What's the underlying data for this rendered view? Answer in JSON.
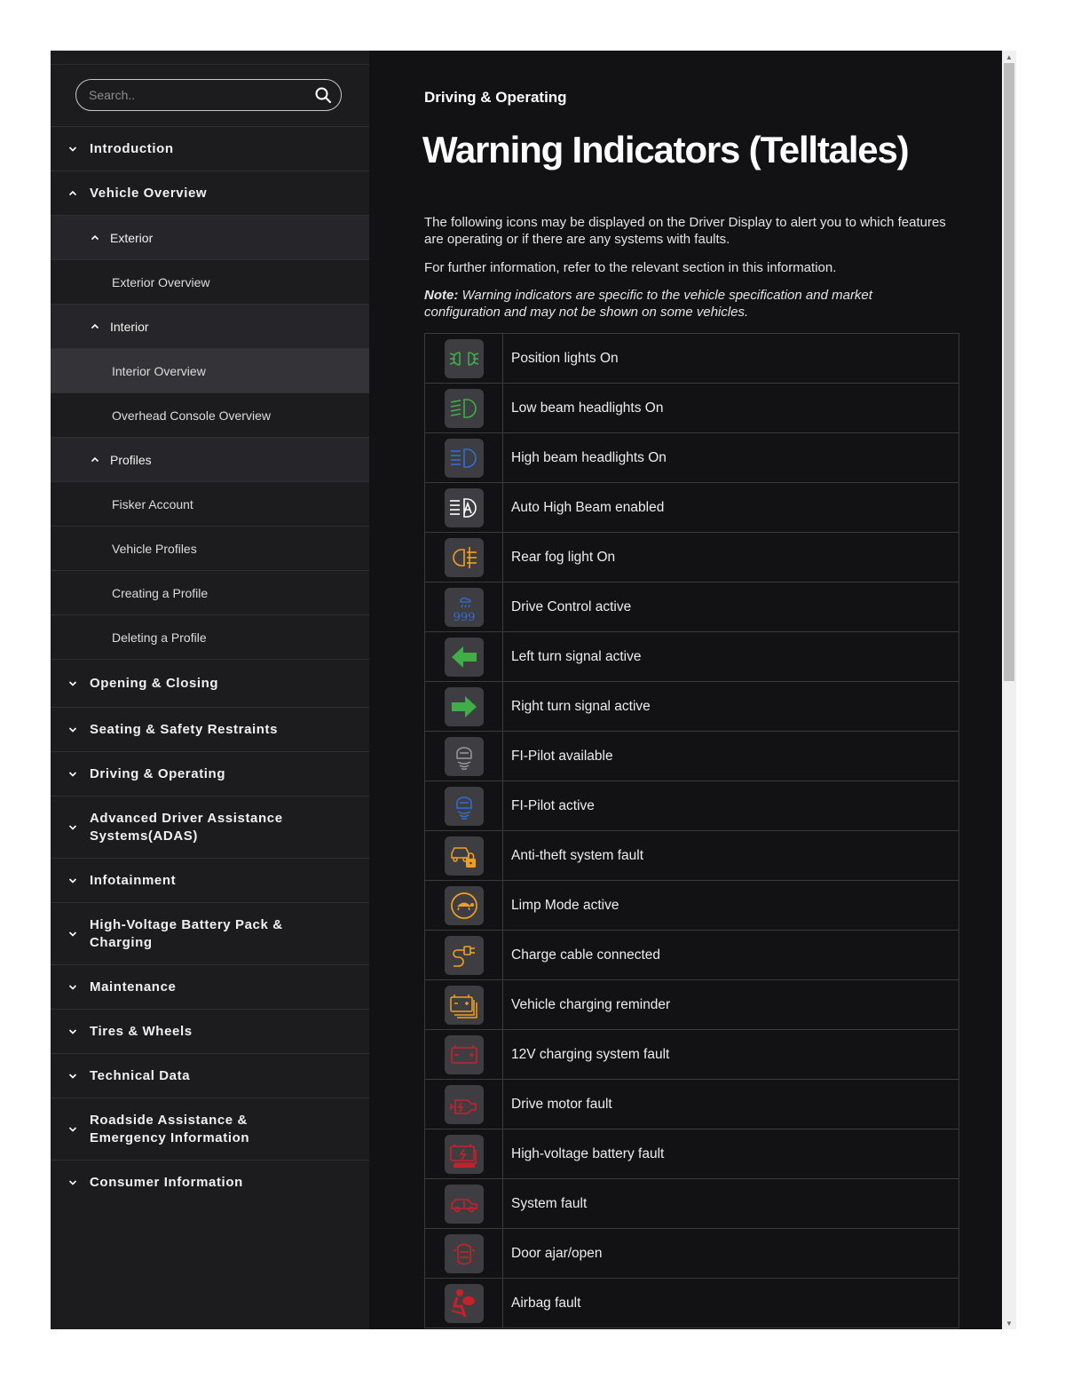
{
  "search": {
    "placeholder": "Search.."
  },
  "sidebar": {
    "items": [
      {
        "label": "Introduction",
        "level": 1,
        "expanded": false
      },
      {
        "label": "Vehicle Overview",
        "level": 1,
        "expanded": true
      },
      {
        "label": "Exterior",
        "level": 2,
        "expanded": true
      },
      {
        "label": "Exterior Overview",
        "level": 3
      },
      {
        "label": "Interior",
        "level": 2,
        "expanded": true
      },
      {
        "label": "Interior Overview",
        "level": 3,
        "active": true
      },
      {
        "label": "Overhead Console Overview",
        "level": 3
      },
      {
        "label": "Profiles",
        "level": 2,
        "expanded": true
      },
      {
        "label": "Fisker Account",
        "level": 3
      },
      {
        "label": "Vehicle Profiles",
        "level": 3
      },
      {
        "label": "Creating a Profile",
        "level": 3
      },
      {
        "label": "Deleting a Profile",
        "level": 3
      },
      {
        "label": "Opening & Closing",
        "level": 1,
        "expanded": false
      },
      {
        "label": "Seating & Safety Restraints",
        "level": 1,
        "expanded": false
      },
      {
        "label": "Driving & Operating",
        "level": 1,
        "expanded": false
      },
      {
        "label": "Advanced Driver Assistance Systems(ADAS)",
        "level": 1,
        "expanded": false
      },
      {
        "label": "Infotainment",
        "level": 1,
        "expanded": false
      },
      {
        "label": "High-Voltage Battery Pack & Charging",
        "level": 1,
        "expanded": false
      },
      {
        "label": "Maintenance",
        "level": 1,
        "expanded": false
      },
      {
        "label": "Tires & Wheels",
        "level": 1,
        "expanded": false
      },
      {
        "label": "Technical Data",
        "level": 1,
        "expanded": false
      },
      {
        "label": "Roadside Assistance & Emergency Information",
        "level": 1,
        "expanded": false
      },
      {
        "label": "Consumer Information",
        "level": 1,
        "expanded": false
      }
    ]
  },
  "main": {
    "breadcrumb": "Driving & Operating",
    "title": "Warning Indicators (Telltales)",
    "intro": "The following icons may be displayed on the Driver Display to alert you to which features are operating or if there are any systems with faults.",
    "further": "For further information, refer to the relevant section in this information.",
    "note_label": "Note:",
    "note_text": " Warning indicators are specific to the vehicle specification and market configuration and may not be shown on some vehicles."
  },
  "telltales": [
    {
      "label": "Position lights On",
      "icon": "position-lights-icon",
      "color": "#3fae49"
    },
    {
      "label": "Low beam headlights On",
      "icon": "low-beam-icon",
      "color": "#3fae49"
    },
    {
      "label": "High beam headlights On",
      "icon": "high-beam-icon",
      "color": "#2f6fd6"
    },
    {
      "label": "Auto High Beam enabled",
      "icon": "auto-high-beam-icon",
      "color": "#ffffff"
    },
    {
      "label": "Rear fog light On",
      "icon": "rear-fog-icon",
      "color": "#f0a020"
    },
    {
      "label": "Drive Control active",
      "icon": "drive-control-icon",
      "color": "#2f6fd6"
    },
    {
      "label": "Left turn signal active",
      "icon": "left-turn-icon",
      "color": "#3fae49"
    },
    {
      "label": "Right turn signal active",
      "icon": "right-turn-icon",
      "color": "#3fae49"
    },
    {
      "label": "FI-Pilot available",
      "icon": "fi-pilot-available-icon",
      "color": "#9a9a9e"
    },
    {
      "label": "FI-Pilot active",
      "icon": "fi-pilot-active-icon",
      "color": "#2f6fd6"
    },
    {
      "label": "Anti-theft system fault",
      "icon": "anti-theft-icon",
      "color": "#f0a020"
    },
    {
      "label": "Limp Mode active",
      "icon": "limp-mode-icon",
      "color": "#f0a020"
    },
    {
      "label": "Charge cable connected",
      "icon": "charge-cable-icon",
      "color": "#f0a020"
    },
    {
      "label": "Vehicle charging reminder",
      "icon": "charging-reminder-icon",
      "color": "#f0a020"
    },
    {
      "label": "12V charging system fault",
      "icon": "12v-battery-icon",
      "color": "#c8202a"
    },
    {
      "label": "Drive motor fault",
      "icon": "drive-motor-icon",
      "color": "#c8202a"
    },
    {
      "label": "High-voltage battery fault",
      "icon": "hv-battery-icon",
      "color": "#c8202a"
    },
    {
      "label": "System fault",
      "icon": "system-fault-icon",
      "color": "#c8202a"
    },
    {
      "label": "Door ajar/open",
      "icon": "door-ajar-icon",
      "color": "#c8202a"
    },
    {
      "label": "Airbag fault",
      "icon": "airbag-icon",
      "color": "#c8202a"
    }
  ]
}
